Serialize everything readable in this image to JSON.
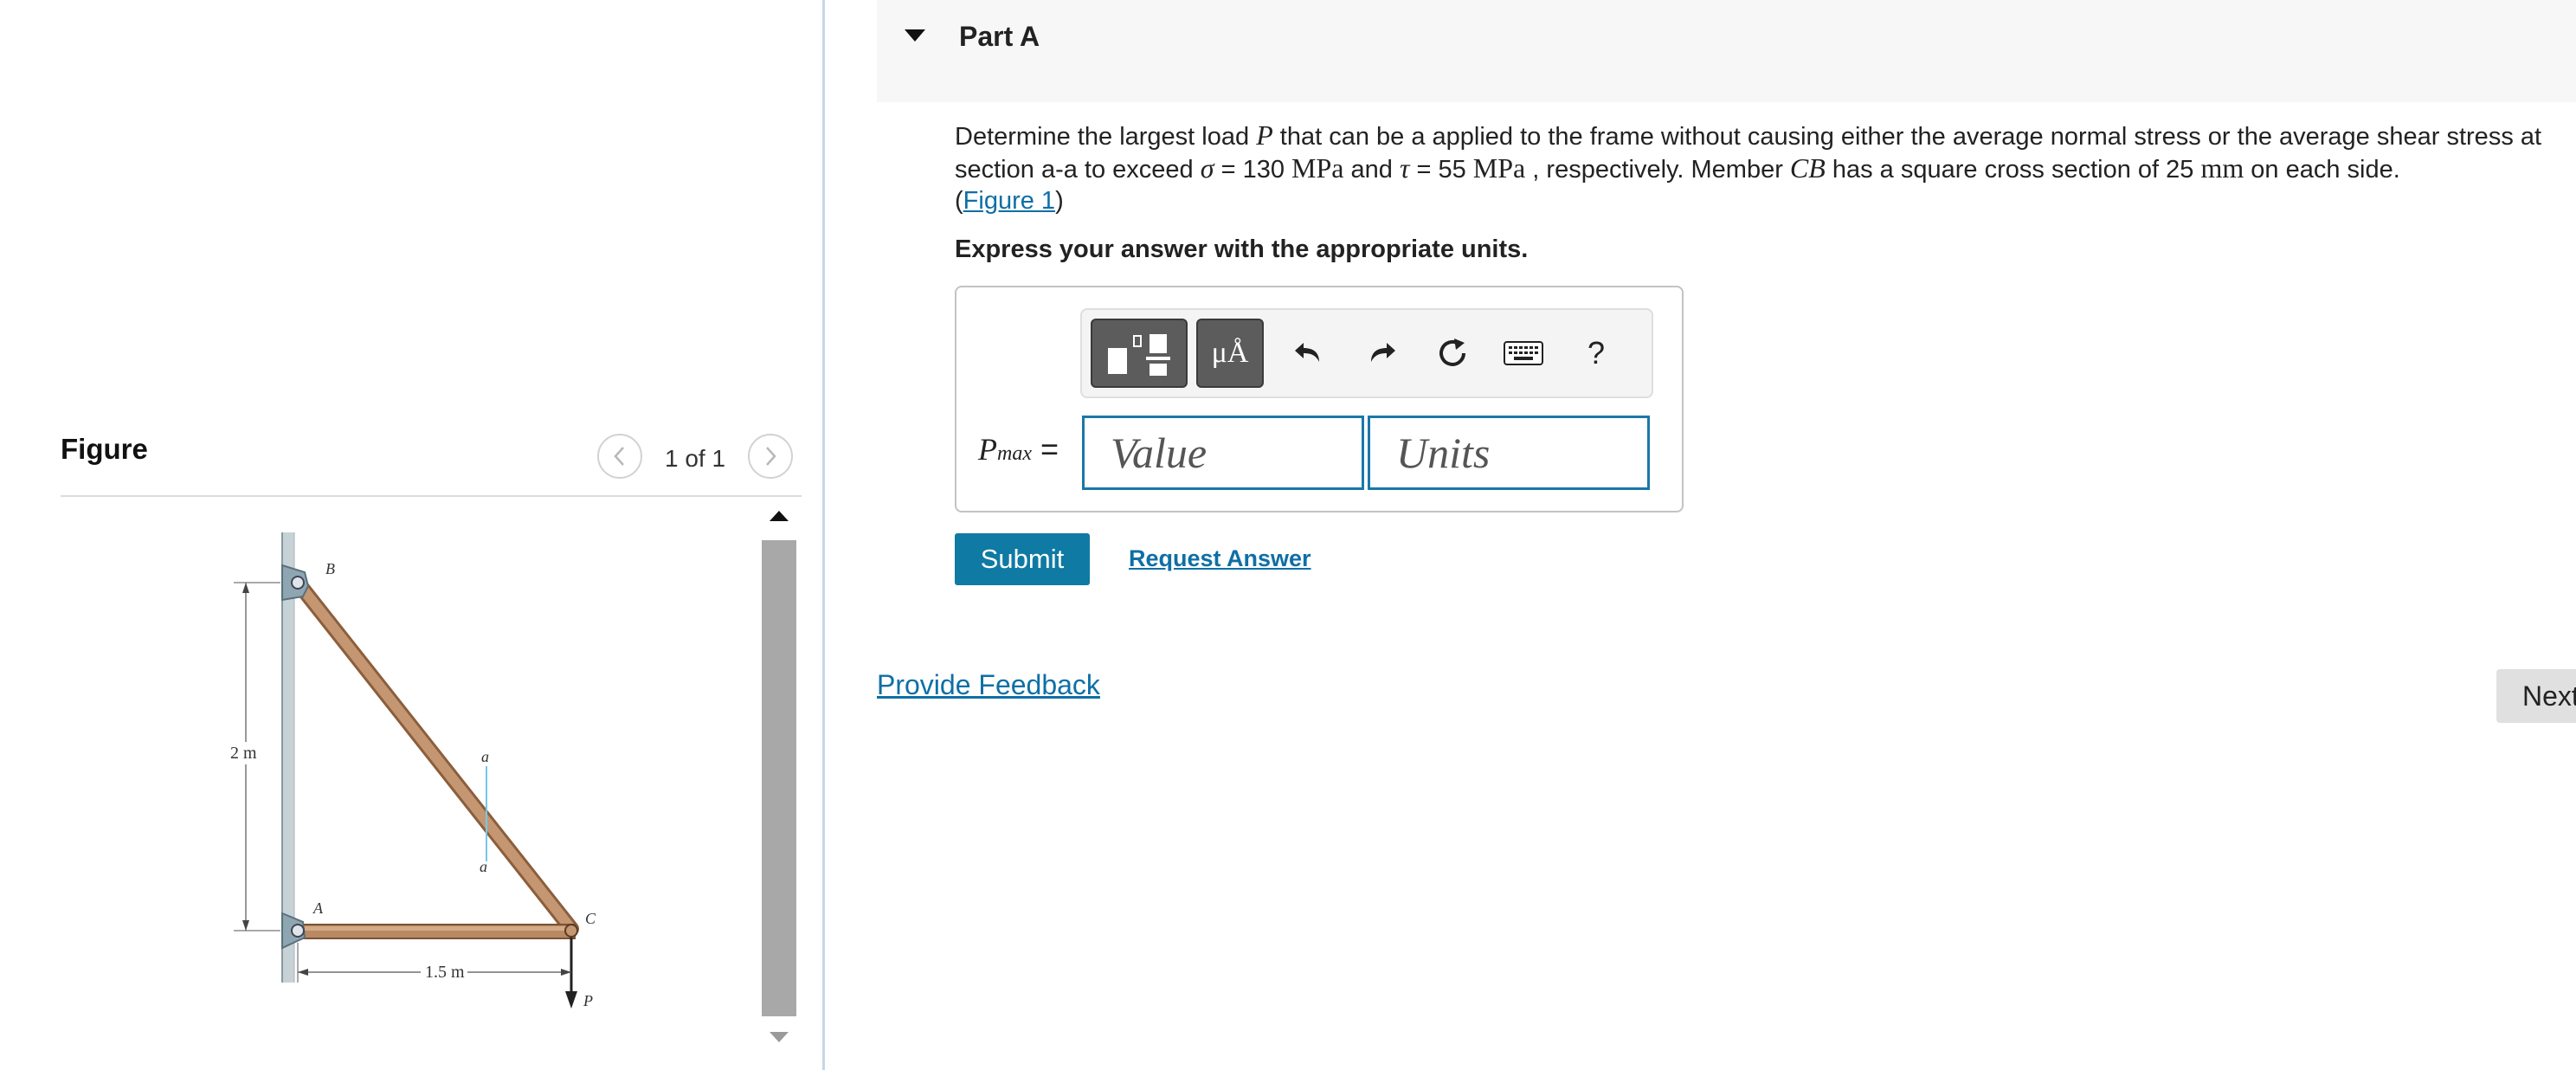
{
  "figure_panel": {
    "heading": "Figure",
    "counter": "1 of 1",
    "image": {
      "labels": {
        "point_b": "B",
        "point_a": "A",
        "point_c": "C",
        "section_top": "a",
        "section_bottom": "a",
        "load": "P",
        "height": "2 m",
        "width": "1.5 m"
      }
    }
  },
  "part": {
    "title": "Part A",
    "problem": {
      "t1": "Determine the largest load ",
      "load_symbol": "P",
      "t2": " that can be a applied to the frame without causing either the average normal stress or the average shear stress at section a-a to exceed ",
      "sigma": "σ",
      "t3": " = 130 ",
      "stress_unit_1": "MPa",
      "t4": " and ",
      "tau": "τ",
      "t5": " = 55 ",
      "stress_unit_2": "MPa",
      "t6": " , respectively. Member ",
      "member": "CB",
      "t7": " has a square cross section of 25 ",
      "length_unit": "mm",
      "t8": " on each side.",
      "paren_open": "(",
      "figure_link": "Figure 1",
      "paren_close": ")"
    },
    "instruction": "Express your answer with the appropriate units.",
    "answer": {
      "label_symbol": "P",
      "label_subscript": "max",
      "label_equals": " =",
      "value_placeholder": "Value",
      "units_placeholder": "Units",
      "toolbar": {
        "symbols_label": "μÅ",
        "help_label": "?"
      }
    },
    "submit_label": "Submit",
    "request_answer_label": "Request Answer"
  },
  "feedback_label": "Provide Feedback",
  "next_label": "Next"
}
